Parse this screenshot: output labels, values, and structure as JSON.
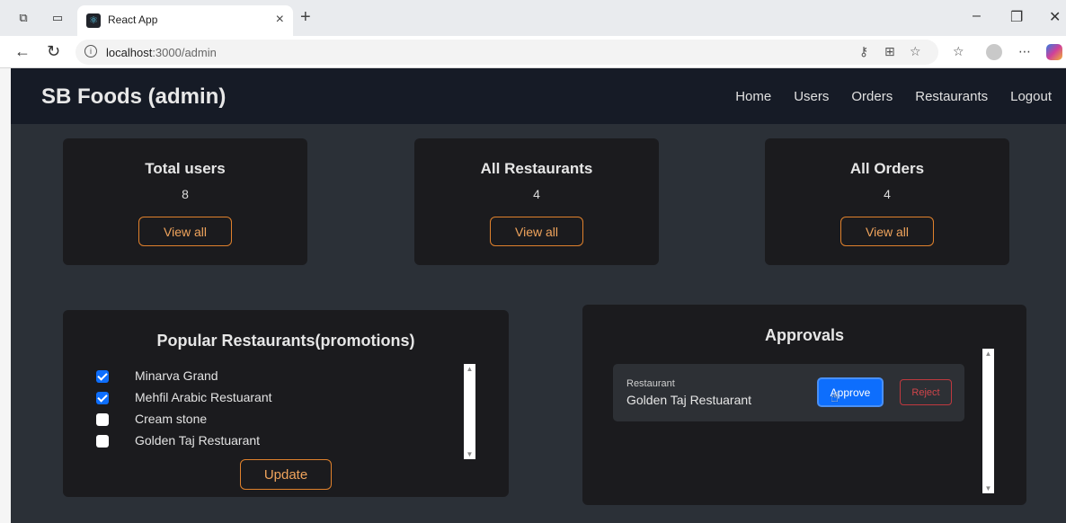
{
  "browser": {
    "tab_title": "React App",
    "url_host": "localhost",
    "url_path": ":3000/admin"
  },
  "navbar": {
    "brand": "SB Foods (admin)",
    "links": [
      "Home",
      "Users",
      "Orders",
      "Restaurants",
      "Logout"
    ]
  },
  "stats": [
    {
      "title": "Total users",
      "value": "8",
      "button": "View all"
    },
    {
      "title": "All Restaurants",
      "value": "4",
      "button": "View all"
    },
    {
      "title": "All Orders",
      "value": "4",
      "button": "View all"
    }
  ],
  "popular": {
    "title": "Popular Restaurants(promotions)",
    "items": [
      {
        "label": "Minarva Grand",
        "checked": true
      },
      {
        "label": "Mehfil Arabic Restuarant",
        "checked": true
      },
      {
        "label": "Cream stone",
        "checked": false
      },
      {
        "label": "Golden Taj Restuarant",
        "checked": false
      }
    ],
    "update_button": "Update"
  },
  "approvals": {
    "title": "Approvals",
    "items": [
      {
        "caption": "Restaurant",
        "name": "Golden Taj Restuarant",
        "approve": "Approve",
        "reject": "Reject"
      }
    ]
  }
}
